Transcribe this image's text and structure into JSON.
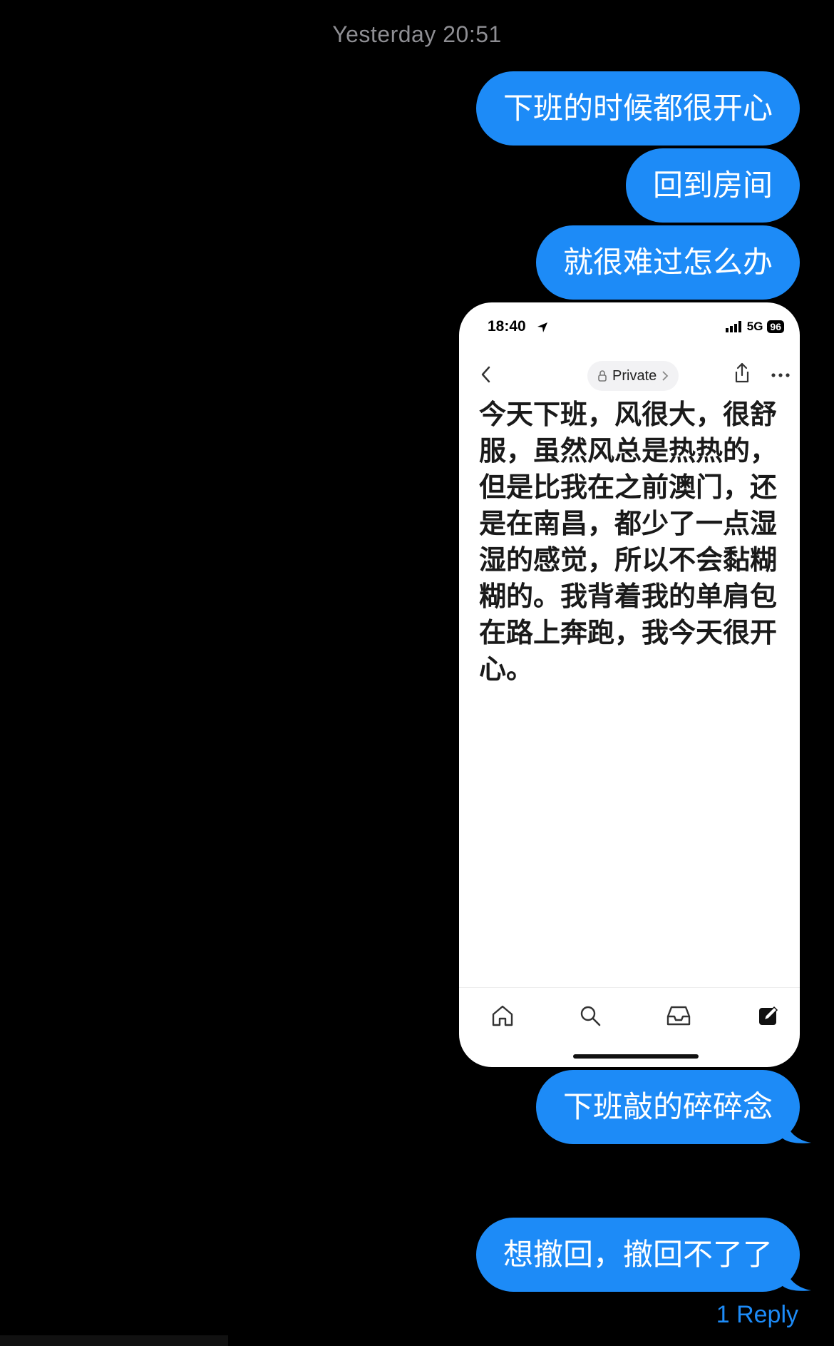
{
  "thread": {
    "timestamp_day": "Yesterday",
    "timestamp_time": "20:51"
  },
  "messages": [
    {
      "text": "下班的时候都很开心"
    },
    {
      "text": "回到房间"
    },
    {
      "text": "就很难过怎么办"
    },
    {
      "text": "下班敲的碎碎念"
    },
    {
      "text": "想撤回，撤回不了了"
    }
  ],
  "screenshot": {
    "status_time": "18:40",
    "network": "5G",
    "battery": "96",
    "privacy_label": "Private",
    "note_body": "今天下班，风很大，很舒服，虽然风总是热热的，但是比我在之前澳门，还是在南昌，都少了一点湿湿的感觉，所以不会黏糊糊的。我背着我的单肩包在路上奔跑，我今天很开心。",
    "tabs": [
      "home-icon",
      "search-icon",
      "inbox-icon",
      "compose-icon"
    ]
  },
  "reply_label": "1 Reply",
  "colors": {
    "bubble": "#1d8bf7",
    "background": "#000000",
    "timestamp": "#8e8e93"
  }
}
